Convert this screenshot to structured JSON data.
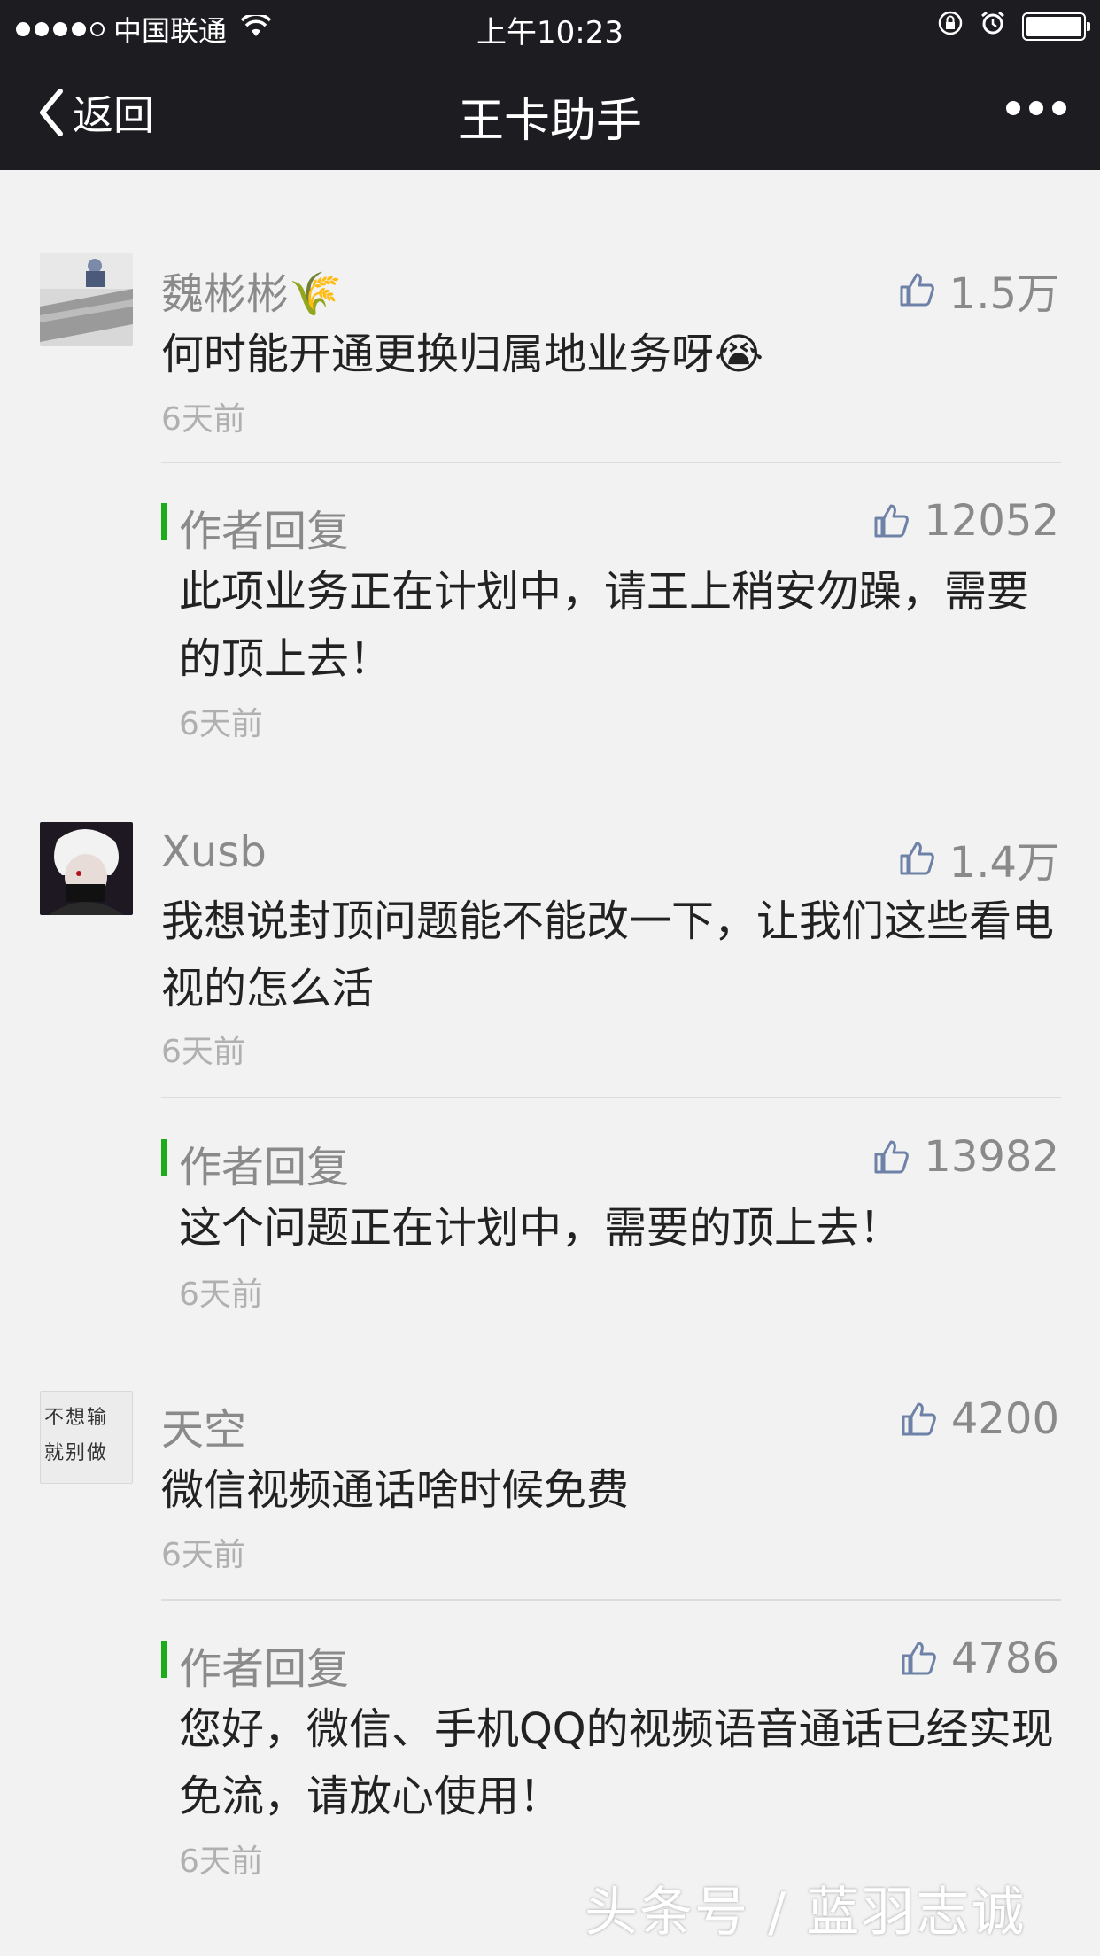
{
  "status_bar": {
    "carrier": "中国联通",
    "time": "上午10:23"
  },
  "nav": {
    "back_label": "返回",
    "title": "王卡助手"
  },
  "comments": [
    {
      "name": "魏彬彬🌾",
      "likes": "1.5万",
      "text": "何时能开通更换归属地业务呀😭",
      "time": "6天前",
      "reply": {
        "label": "作者回复",
        "likes": "12052",
        "text": "此项业务正在计划中，请王上稍安勿躁，需要的顶上去！",
        "time": "6天前"
      }
    },
    {
      "name": "Xusb",
      "likes": "1.4万",
      "text": "我想说封顶问题能不能改一下，让我们这些看电视的怎么活",
      "time": "6天前",
      "reply": {
        "label": "作者回复",
        "likes": "13982",
        "text": "这个问题正在计划中，需要的顶上去！",
        "time": "6天前"
      }
    },
    {
      "name": "天空",
      "avatar_text": "不想输就别做",
      "likes": "4200",
      "text": "微信视频通话啥时候免费",
      "time": "6天前",
      "reply": {
        "label": "作者回复",
        "likes": "4786",
        "text": "您好，微信、手机QQ的视频语音通话已经实现免流，请放心使用！",
        "time": "6天前"
      }
    }
  ],
  "watermark": "头条号 / 蓝羽志诚",
  "colors": {
    "bar_bg": "#1c1c21",
    "page_bg": "#f2f2f2",
    "reply_accent": "#1aad19",
    "like_icon": "#6e82a8"
  }
}
